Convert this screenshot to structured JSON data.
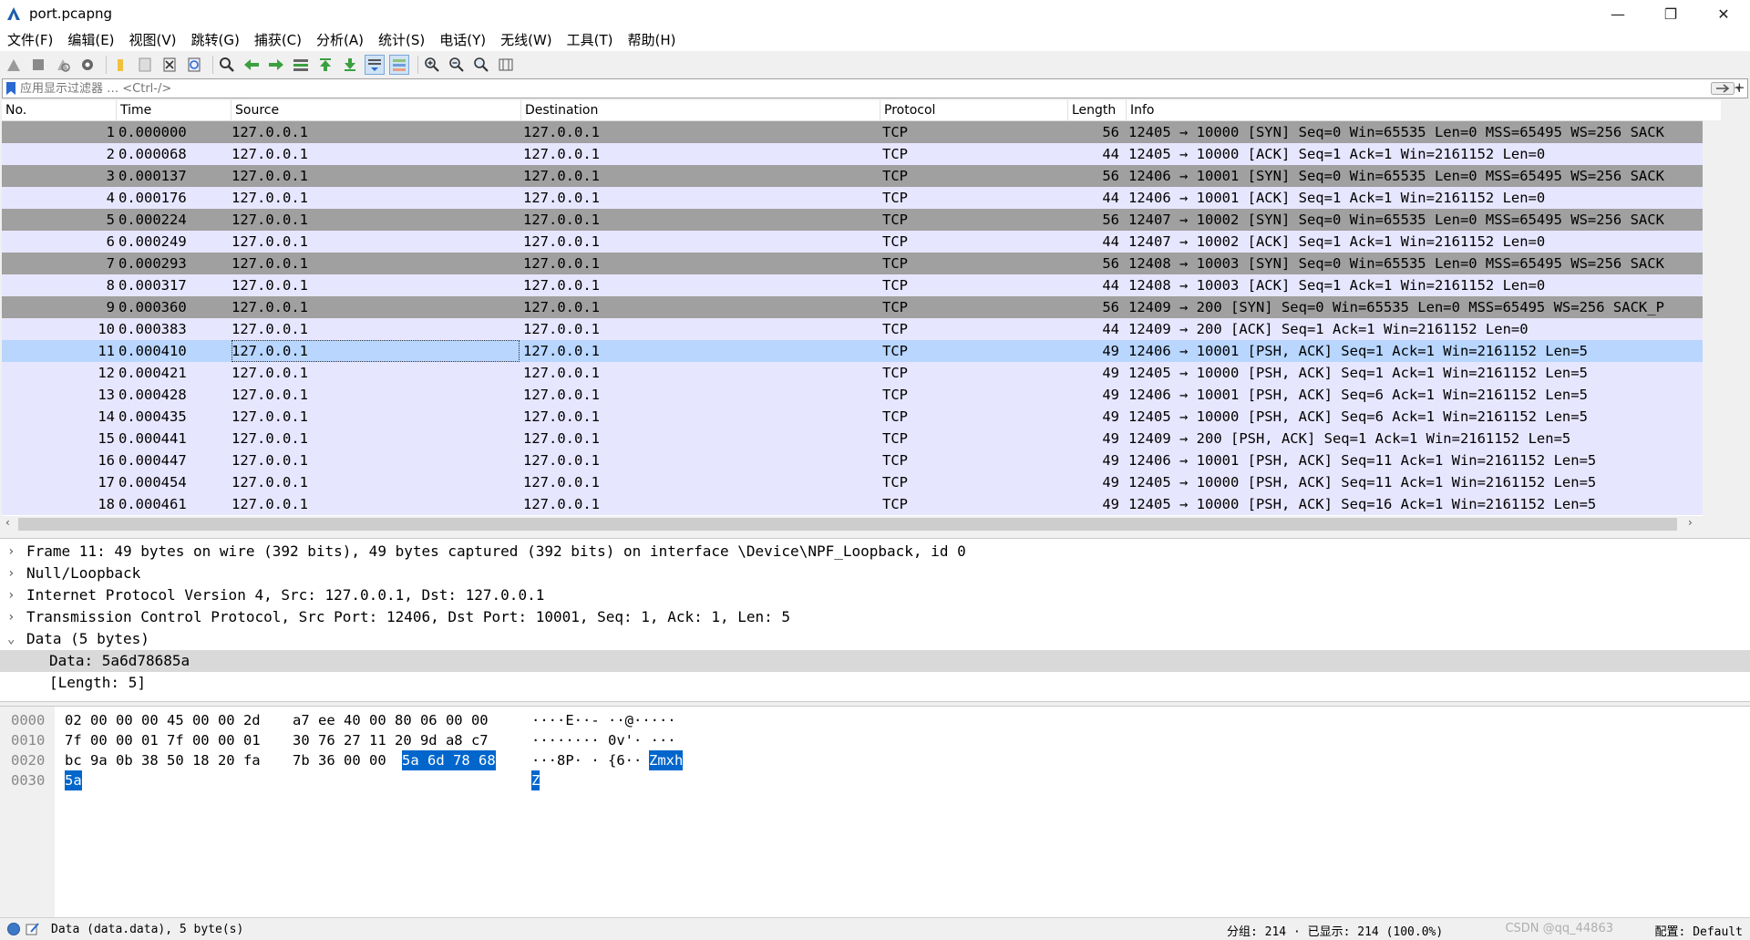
{
  "window": {
    "title": "port.pcapng",
    "minimize": "—",
    "restore": "❐",
    "close": "✕"
  },
  "menu": [
    "文件(F)",
    "编辑(E)",
    "视图(V)",
    "跳转(G)",
    "捕获(C)",
    "分析(A)",
    "统计(S)",
    "电话(Y)",
    "无线(W)",
    "工具(T)",
    "帮助(H)"
  ],
  "toolbar_icons": [
    "shark-fin-start-icon",
    "stop-capture-icon",
    "restart-capture-icon",
    "capture-options-icon",
    "open-file-icon",
    "save-file-icon",
    "close-file-icon",
    "reload-file-icon",
    "find-packet-icon",
    "go-back-icon",
    "go-forward-icon",
    "go-to-packet-icon",
    "first-packet-icon",
    "last-packet-icon",
    "autoscroll-icon",
    "colorize-icon",
    "zoom-in-icon",
    "zoom-out-icon",
    "zoom-normal-icon",
    "resize-columns-icon"
  ],
  "filter": {
    "placeholder": "应用显示过滤器 … <Ctrl-/>",
    "plus": "+"
  },
  "columns": [
    "No.",
    "Time",
    "Source",
    "Destination",
    "Protocol",
    "Length",
    "Info"
  ],
  "packets": [
    {
      "no": "1",
      "time": "0.000000",
      "src": "127.0.0.1",
      "dst": "127.0.0.1",
      "proto": "TCP",
      "len": "56",
      "info": "12405 → 10000 [SYN] Seq=0 Win=65535 Len=0 MSS=65495 WS=256 SACK",
      "style": "syn"
    },
    {
      "no": "2",
      "time": "0.000068",
      "src": "127.0.0.1",
      "dst": "127.0.0.1",
      "proto": "TCP",
      "len": "44",
      "info": "12405 → 10000 [ACK] Seq=1 Ack=1 Win=2161152 Len=0",
      "style": "norm"
    },
    {
      "no": "3",
      "time": "0.000137",
      "src": "127.0.0.1",
      "dst": "127.0.0.1",
      "proto": "TCP",
      "len": "56",
      "info": "12406 → 10001 [SYN] Seq=0 Win=65535 Len=0 MSS=65495 WS=256 SACK",
      "style": "syn"
    },
    {
      "no": "4",
      "time": "0.000176",
      "src": "127.0.0.1",
      "dst": "127.0.0.1",
      "proto": "TCP",
      "len": "44",
      "info": "12406 → 10001 [ACK] Seq=1 Ack=1 Win=2161152 Len=0",
      "style": "norm"
    },
    {
      "no": "5",
      "time": "0.000224",
      "src": "127.0.0.1",
      "dst": "127.0.0.1",
      "proto": "TCP",
      "len": "56",
      "info": "12407 → 10002 [SYN] Seq=0 Win=65535 Len=0 MSS=65495 WS=256 SACK",
      "style": "syn"
    },
    {
      "no": "6",
      "time": "0.000249",
      "src": "127.0.0.1",
      "dst": "127.0.0.1",
      "proto": "TCP",
      "len": "44",
      "info": "12407 → 10002 [ACK] Seq=1 Ack=1 Win=2161152 Len=0",
      "style": "norm"
    },
    {
      "no": "7",
      "time": "0.000293",
      "src": "127.0.0.1",
      "dst": "127.0.0.1",
      "proto": "TCP",
      "len": "56",
      "info": "12408 → 10003 [SYN] Seq=0 Win=65535 Len=0 MSS=65495 WS=256 SACK",
      "style": "syn"
    },
    {
      "no": "8",
      "time": "0.000317",
      "src": "127.0.0.1",
      "dst": "127.0.0.1",
      "proto": "TCP",
      "len": "44",
      "info": "12408 → 10003 [ACK] Seq=1 Ack=1 Win=2161152 Len=0",
      "style": "norm"
    },
    {
      "no": "9",
      "time": "0.000360",
      "src": "127.0.0.1",
      "dst": "127.0.0.1",
      "proto": "TCP",
      "len": "56",
      "info": "12409 → 200 [SYN] Seq=0 Win=65535 Len=0 MSS=65495 WS=256 SACK_P",
      "style": "syn"
    },
    {
      "no": "10",
      "time": "0.000383",
      "src": "127.0.0.1",
      "dst": "127.0.0.1",
      "proto": "TCP",
      "len": "44",
      "info": "12409 → 200 [ACK] Seq=1 Ack=1 Win=2161152 Len=0",
      "style": "norm"
    },
    {
      "no": "11",
      "time": "0.000410",
      "src": "127.0.0.1",
      "dst": "127.0.0.1",
      "proto": "TCP",
      "len": "49",
      "info": "12406 → 10001 [PSH, ACK] Seq=1 Ack=1 Win=2161152 Len=5",
      "style": "sel"
    },
    {
      "no": "12",
      "time": "0.000421",
      "src": "127.0.0.1",
      "dst": "127.0.0.1",
      "proto": "TCP",
      "len": "49",
      "info": "12405 → 10000 [PSH, ACK] Seq=1 Ack=1 Win=2161152 Len=5",
      "style": "norm"
    },
    {
      "no": "13",
      "time": "0.000428",
      "src": "127.0.0.1",
      "dst": "127.0.0.1",
      "proto": "TCP",
      "len": "49",
      "info": "12406 → 10001 [PSH, ACK] Seq=6 Ack=1 Win=2161152 Len=5",
      "style": "norm"
    },
    {
      "no": "14",
      "time": "0.000435",
      "src": "127.0.0.1",
      "dst": "127.0.0.1",
      "proto": "TCP",
      "len": "49",
      "info": "12405 → 10000 [PSH, ACK] Seq=6 Ack=1 Win=2161152 Len=5",
      "style": "norm"
    },
    {
      "no": "15",
      "time": "0.000441",
      "src": "127.0.0.1",
      "dst": "127.0.0.1",
      "proto": "TCP",
      "len": "49",
      "info": "12409 → 200 [PSH, ACK] Seq=1 Ack=1 Win=2161152 Len=5",
      "style": "norm"
    },
    {
      "no": "16",
      "time": "0.000447",
      "src": "127.0.0.1",
      "dst": "127.0.0.1",
      "proto": "TCP",
      "len": "49",
      "info": "12406 → 10001 [PSH, ACK] Seq=11 Ack=1 Win=2161152 Len=5",
      "style": "norm"
    },
    {
      "no": "17",
      "time": "0.000454",
      "src": "127.0.0.1",
      "dst": "127.0.0.1",
      "proto": "TCP",
      "len": "49",
      "info": "12405 → 10000 [PSH, ACK] Seq=11 Ack=1 Win=2161152 Len=5",
      "style": "norm"
    },
    {
      "no": "18",
      "time": "0.000461",
      "src": "127.0.0.1",
      "dst": "127.0.0.1",
      "proto": "TCP",
      "len": "49",
      "info": "12405 → 10000 [PSH, ACK] Seq=16 Ack=1 Win=2161152 Len=5",
      "style": "norm"
    }
  ],
  "details": [
    {
      "arrow": "›",
      "indent": 0,
      "text": "Frame 11: 49 bytes on wire (392 bits), 49 bytes captured (392 bits) on interface \\Device\\NPF_Loopback, id 0",
      "hl": false
    },
    {
      "arrow": "›",
      "indent": 0,
      "text": "Null/Loopback",
      "hl": false
    },
    {
      "arrow": "›",
      "indent": 0,
      "text": "Internet Protocol Version 4, Src: 127.0.0.1, Dst: 127.0.0.1",
      "hl": false
    },
    {
      "arrow": "›",
      "indent": 0,
      "text": "Transmission Control Protocol, Src Port: 12406, Dst Port: 10001, Seq: 1, Ack: 1, Len: 5",
      "hl": false
    },
    {
      "arrow": "⌄",
      "indent": 0,
      "text": "Data (5 bytes)",
      "hl": false
    },
    {
      "arrow": "",
      "indent": 1,
      "text": "Data: 5a6d78685a",
      "hl": true
    },
    {
      "arrow": "",
      "indent": 1,
      "text": "[Length: 5]",
      "hl": false
    }
  ],
  "bytes": [
    {
      "offset": "0000",
      "hex": [
        "02 00 00 00 45 00 00 2d",
        "a7 ee 40 00 80 06 00 00"
      ],
      "hex_hl": "",
      "ascii": "····E··-  ··@·····",
      "ascii_hl": ""
    },
    {
      "offset": "0010",
      "hex": [
        "7f 00 00 01 7f 00 00 01",
        "30 76 27 11 20 9d a8 c7"
      ],
      "hex_hl": "",
      "ascii": "········ 0v'· ···",
      "ascii_hl": ""
    },
    {
      "offset": "0020",
      "hex": [
        "bc 9a 0b 38 50 18 20 fa",
        "7b 36 00 00"
      ],
      "hex_hl": "5a 6d 78 68",
      "ascii": "···8P· · {6··",
      "ascii_hl": "Zmxh"
    },
    {
      "offset": "0030",
      "hex": [
        "",
        ""
      ],
      "hex_hl": "5a",
      "ascii": "",
      "ascii_hl": "Z"
    }
  ],
  "status": {
    "text": "Data (data.data), 5 byte(s)",
    "counts": "分组: 214 · 已显示: 214 (100.0%)",
    "profile": "配置: Default",
    "watermark": "CSDN @qq_44863"
  }
}
